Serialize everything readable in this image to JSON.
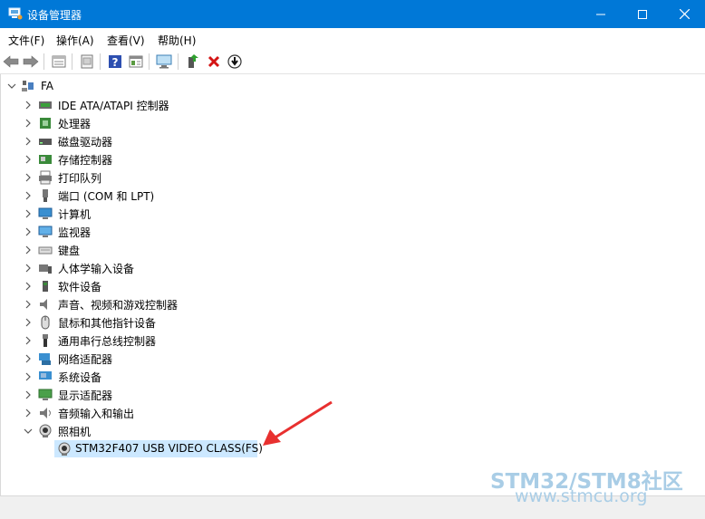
{
  "window": {
    "title": "设备管理器",
    "controls": [
      "minimize",
      "maximize",
      "close"
    ]
  },
  "menu": [
    {
      "label": "文件(F)"
    },
    {
      "label": "操作(A)"
    },
    {
      "label": "查看(V)"
    },
    {
      "label": "帮助(H)"
    }
  ],
  "toolbar": {
    "buttons": [
      "back-icon",
      "forward-icon",
      "properties-icon",
      "update-driver-icon",
      "help-icon",
      "view-icon",
      "scan-hardware-icon",
      "enable-device-icon",
      "uninstall-icon",
      "download-icon"
    ]
  },
  "tree": {
    "root": "FA",
    "categories": [
      {
        "label": "IDE ATA/ATAPI 控制器",
        "icon": "ide-controller-icon"
      },
      {
        "label": "处理器",
        "icon": "processor-icon"
      },
      {
        "label": "磁盘驱动器",
        "icon": "disk-drive-icon"
      },
      {
        "label": "存储控制器",
        "icon": "storage-controller-icon"
      },
      {
        "label": "打印队列",
        "icon": "printer-icon"
      },
      {
        "label": "端口 (COM 和 LPT)",
        "icon": "port-icon"
      },
      {
        "label": "计算机",
        "icon": "computer-icon"
      },
      {
        "label": "监视器",
        "icon": "monitor-icon"
      },
      {
        "label": "键盘",
        "icon": "keyboard-icon"
      },
      {
        "label": "人体学输入设备",
        "icon": "hid-icon"
      },
      {
        "label": "软件设备",
        "icon": "software-device-icon"
      },
      {
        "label": "声音、视频和游戏控制器",
        "icon": "sound-icon"
      },
      {
        "label": "鼠标和其他指针设备",
        "icon": "mouse-icon"
      },
      {
        "label": "通用串行总线控制器",
        "icon": "usb-icon"
      },
      {
        "label": "网络适配器",
        "icon": "network-adapter-icon"
      },
      {
        "label": "系统设备",
        "icon": "system-device-icon"
      },
      {
        "label": "显示适配器",
        "icon": "display-adapter-icon"
      },
      {
        "label": "音频输入和输出",
        "icon": "audio-io-icon"
      },
      {
        "label": "照相机",
        "icon": "camera-icon"
      }
    ],
    "camera_child": "STM32F407 USB VIDEO CLASS(FS)"
  },
  "watermark": {
    "line1": "STM32/STM8社区",
    "line2": "www.stmcu.org"
  },
  "colors": {
    "titlebar": "#0078d7",
    "selection": "#cce8ff",
    "arrow": "#e8302f",
    "watermark": "#a9cde6"
  }
}
